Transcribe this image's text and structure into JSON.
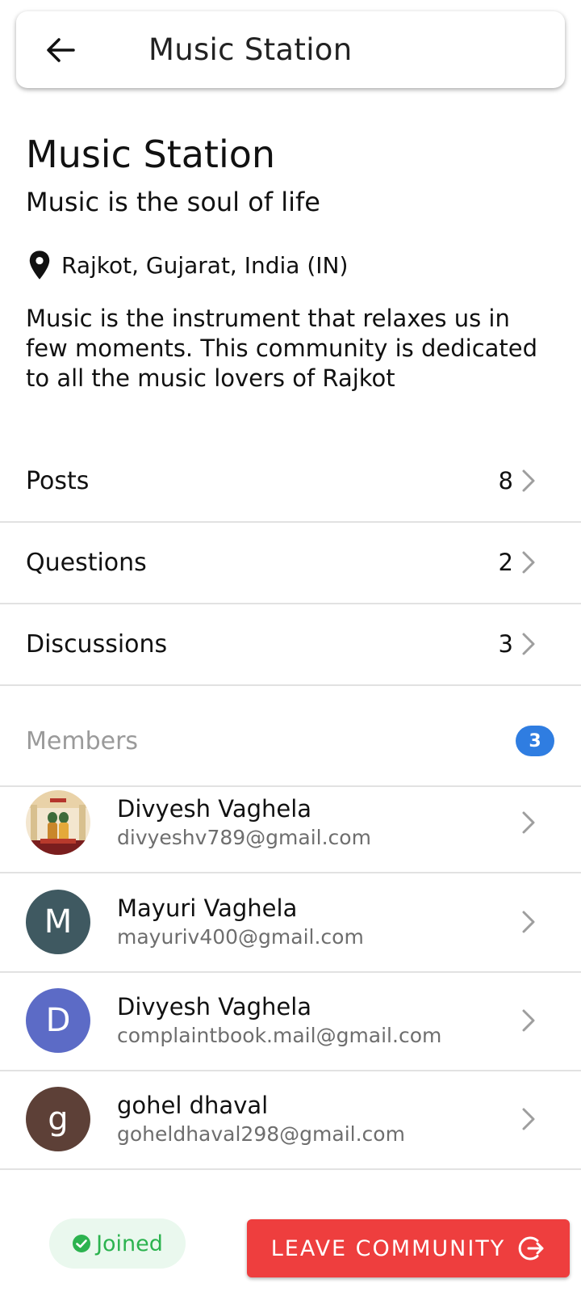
{
  "appbar": {
    "title": "Music Station",
    "back_icon": "arrow-left-icon"
  },
  "community": {
    "name": "Music Station",
    "tagline": "Music is the soul of life",
    "location": "Rajkot, Gujarat, India (IN)",
    "description": "Music is the instrument that relaxes us in few moments. This community is dedicated to all the music lovers of Rajkot"
  },
  "sections": [
    {
      "label": "Posts",
      "count": "8"
    },
    {
      "label": "Questions",
      "count": "2"
    },
    {
      "label": "Discussions",
      "count": "3"
    }
  ],
  "members": {
    "label": "Members",
    "count": "3",
    "badge_color": "#2f7de1",
    "list": [
      {
        "name": "Divyesh Vaghela",
        "email": "divyeshv789@gmail.com",
        "avatar_initial": "",
        "avatar_type": "photo"
      },
      {
        "name": "Mayuri Vaghela",
        "email": "mayuriv400@gmail.com",
        "avatar_initial": "M",
        "avatar_color": "#3f5961"
      },
      {
        "name": "Divyesh Vaghela",
        "email": "complaintbook.mail@gmail.com",
        "avatar_initial": "D",
        "avatar_color": "#5c6bc6"
      },
      {
        "name": "gohel dhaval",
        "email": "goheldhaval298@gmail.com",
        "avatar_initial": "g",
        "avatar_color": "#5d4037"
      }
    ]
  },
  "footer": {
    "joined_label": "Joined",
    "joined_color": "#2cb34f",
    "leave_label": "LEAVE COMMUNITY",
    "leave_color": "#ee3e3e"
  }
}
